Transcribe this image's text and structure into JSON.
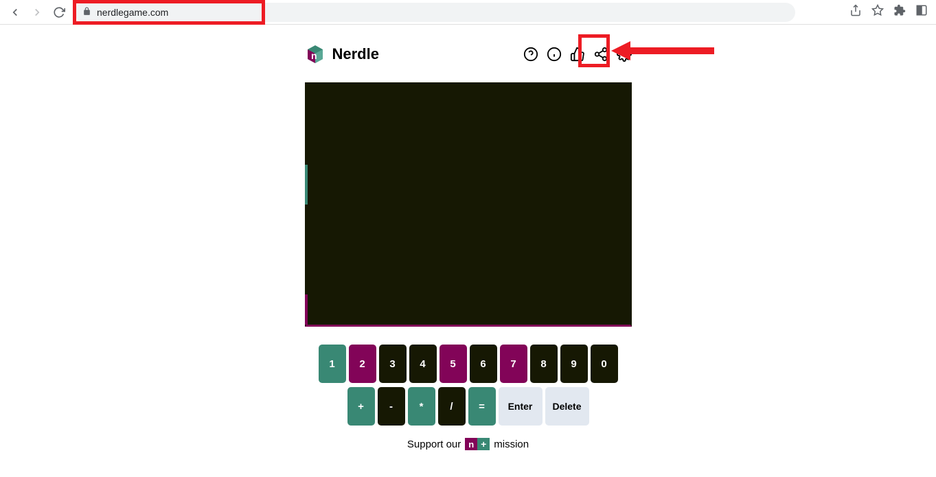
{
  "browser": {
    "url": "nerdlegame.com"
  },
  "header": {
    "title": "Nerdle"
  },
  "keyboard": {
    "row1": [
      {
        "label": "1",
        "state": "green"
      },
      {
        "label": "2",
        "state": "purple"
      },
      {
        "label": "3",
        "state": "black"
      },
      {
        "label": "4",
        "state": "black"
      },
      {
        "label": "5",
        "state": "purple"
      },
      {
        "label": "6",
        "state": "black"
      },
      {
        "label": "7",
        "state": "purple"
      },
      {
        "label": "8",
        "state": "black"
      },
      {
        "label": "9",
        "state": "black"
      },
      {
        "label": "0",
        "state": "black"
      }
    ],
    "row2": [
      {
        "label": "+",
        "state": "green"
      },
      {
        "label": "-",
        "state": "black"
      },
      {
        "label": "*",
        "state": "green"
      },
      {
        "label": "/",
        "state": "black"
      },
      {
        "label": "=",
        "state": "green"
      }
    ],
    "enter": "Enter",
    "delete": "Delete"
  },
  "footer": {
    "prefix": "Support our",
    "suffix": "mission",
    "badge_n": "n",
    "badge_plus": "+"
  },
  "colors": {
    "green": "#398874",
    "purple": "#820458",
    "black": "#161803",
    "highlight": "#ed1c24"
  }
}
